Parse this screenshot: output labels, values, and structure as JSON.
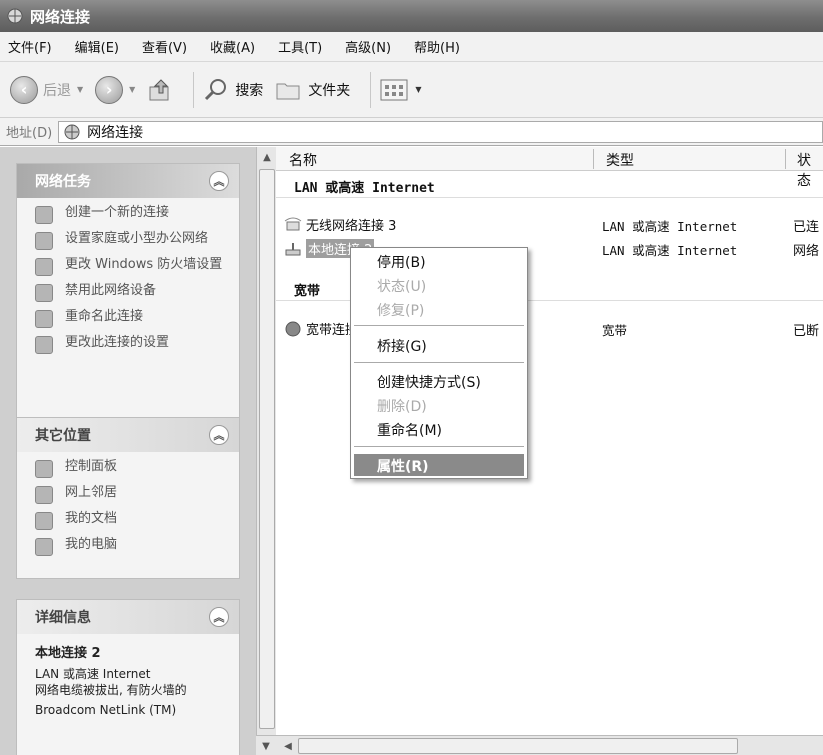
{
  "window": {
    "title": "网络连接"
  },
  "menubar": {
    "items": [
      "文件(F)",
      "编辑(E)",
      "查看(V)",
      "收藏(A)",
      "工具(T)",
      "高级(N)",
      "帮助(H)"
    ]
  },
  "toolbar": {
    "back": "后退",
    "search": "搜索",
    "folders": "文件夹"
  },
  "address": {
    "label": "地址(D)",
    "value": "网络连接"
  },
  "sidebar": {
    "tasks": {
      "title": "网络任务",
      "items": [
        "创建一个新的连接",
        "设置家庭或小型办公网络",
        "更改 Windows 防火墙设置",
        "禁用此网络设备",
        "重命名此连接",
        "更改此连接的设置"
      ]
    },
    "other": {
      "title": "其它位置",
      "items": [
        "控制面板",
        "网上邻居",
        "我的文档",
        "我的电脑"
      ]
    },
    "details": {
      "title": "详细信息",
      "name": "本地连接 2",
      "type": "LAN 或高速 Internet",
      "status": "网络电缆被拔出, 有防火墙的",
      "device": "Broadcom NetLink (TM)"
    }
  },
  "list": {
    "columns": [
      "名称",
      "类型",
      "状态"
    ],
    "groups": [
      {
        "title": "LAN 或高速 Internet"
      },
      {
        "title": "宽带"
      }
    ],
    "rows": [
      {
        "name": "无线网络连接 3",
        "type": "LAN 或高速 Internet",
        "status": "已连"
      },
      {
        "name": "本地连接 2",
        "type": "LAN 或高速 Internet",
        "status": "网络"
      },
      {
        "name": "宽带连接",
        "type": "宽带",
        "status": "已断"
      }
    ]
  },
  "context_menu": {
    "items": [
      "停用(B)",
      "状态(U)",
      "修复(P)",
      "桥接(G)",
      "创建快捷方式(S)",
      "删除(D)",
      "重命名(M)",
      "属性(R)"
    ]
  }
}
